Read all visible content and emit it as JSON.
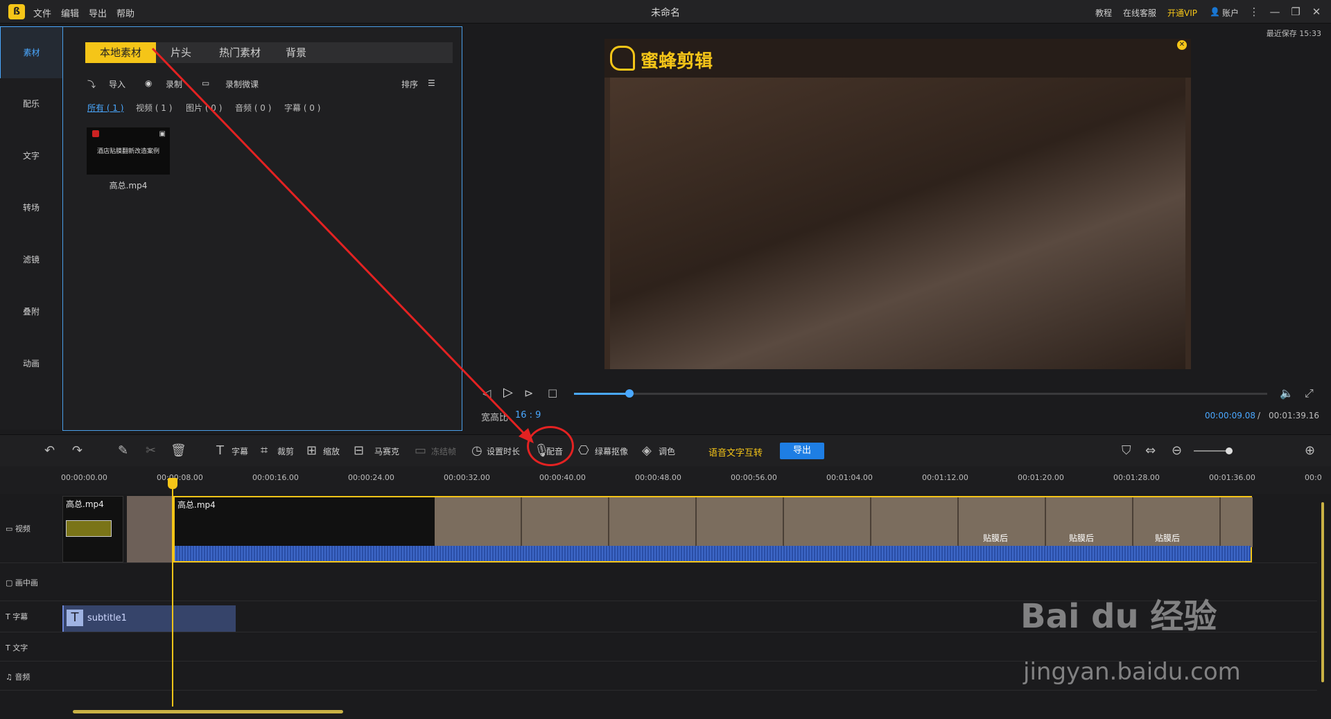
{
  "app": {
    "title": "未命名",
    "menu": [
      "文件",
      "编辑",
      "导出",
      "帮助"
    ],
    "top_links": {
      "tutorial": "教程",
      "support": "在线客服",
      "vip": "开通VIP",
      "account": "账户"
    },
    "last_saved": "最近保存 15:33"
  },
  "sidebar": {
    "items": [
      {
        "label": "素材",
        "active": true
      },
      {
        "label": "配乐"
      },
      {
        "label": "文字"
      },
      {
        "label": "转场"
      },
      {
        "label": "滤镜"
      },
      {
        "label": "叠附"
      },
      {
        "label": "动画"
      }
    ]
  },
  "media": {
    "tabs": [
      {
        "label": "本地素材",
        "active": true
      },
      {
        "label": "片头"
      },
      {
        "label": "热门素材"
      },
      {
        "label": "背景"
      }
    ],
    "actions": {
      "import": "导入",
      "record": "录制",
      "record_lesson": "录制微课",
      "sort": "排序"
    },
    "filters": [
      {
        "label": "所有 ( 1 )",
        "active": true
      },
      {
        "label": "视频 ( 1 )"
      },
      {
        "label": "图片 ( 0 )"
      },
      {
        "label": "音频 ( 0 )"
      },
      {
        "label": "字幕 ( 0 )"
      }
    ],
    "thumbnail": {
      "caption": "高总.mp4",
      "overlay_text": "酒店贴膜翻新改造案例"
    }
  },
  "preview": {
    "watermark": "蜜蜂剪辑",
    "aspect_ratio_label": "宽高比",
    "aspect_ratio": "16 : 9",
    "current_time": "00:00:09.08",
    "separator": "/",
    "total_time": "00:01:39.16",
    "progress": 0.08
  },
  "toolbar": {
    "subtitle": "字幕",
    "crop": "裁剪",
    "zoom": "缩放",
    "mosaic": "马赛克",
    "freeze": "冻结帧",
    "set_duration": "设置时长",
    "voiceover": "配音",
    "green_screen": "绿幕抠像",
    "color": "调色",
    "voice_text": "语音文字互转",
    "export": "导出"
  },
  "ruler": {
    "ticks": [
      "00:00:00.00",
      "00:00:08.00",
      "00:00:16.00",
      "00:00:24.00",
      "00:00:32.00",
      "00:00:40.00",
      "00:00:48.00",
      "00:00:56.00",
      "00:01:04.00",
      "00:01:12.00",
      "00:01:20.00",
      "00:01:28.00",
      "00:01:36.00",
      "00:0"
    ]
  },
  "tracks": {
    "labels": {
      "video": "视频",
      "pip": "画中画",
      "subtitle": "字幕",
      "text": "文字",
      "audio": "音频"
    },
    "clips": {
      "clip1": "高总.mp4",
      "clip2": "高总.mp4",
      "subtitle": "subtitle1"
    },
    "frame_labels": [
      "贴膜后",
      "贴膜后",
      "贴膜后"
    ]
  },
  "watermark_site": {
    "brand": "Bai du 经验",
    "url": "jingyan.baidu.com"
  },
  "colors": {
    "accent": "#f5c518",
    "blue": "#4aa8ff",
    "annotation": "#e32222"
  }
}
